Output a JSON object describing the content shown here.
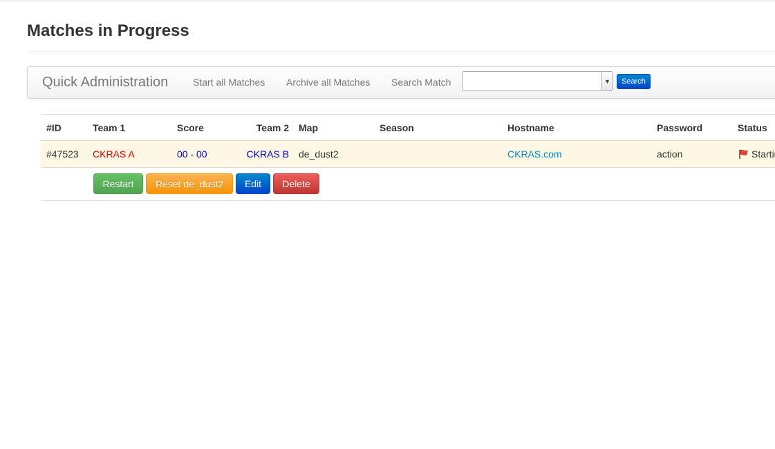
{
  "page": {
    "title": "Matches in Progress"
  },
  "navbar": {
    "brand": "Quick Administration",
    "links": {
      "start_all": "Start all Matches",
      "archive_all": "Archive all Matches"
    },
    "search_label": "Search Match",
    "search_select_value": "",
    "search_button": "Search"
  },
  "table": {
    "headers": {
      "id": "#ID",
      "team1": "Team 1",
      "score": "Score",
      "team2": "Team 2",
      "map": "Map",
      "season": "Season",
      "hostname": "Hostname",
      "password": "Password",
      "status": "Status"
    },
    "rows": [
      {
        "id": "#47523",
        "team1": "CKRAS A",
        "score": "00 - 00",
        "team2": "CKRAS B",
        "map": "de_dust2",
        "season": "",
        "hostname": "CKRAS.com",
        "password": "action",
        "status": "Starting"
      }
    ],
    "actions": {
      "restart": "Restart",
      "reset": "Reset de_dust2",
      "edit": "Edit",
      "delete": "Delete"
    }
  },
  "colors": {
    "team1": "#dd0000",
    "score": "#0000cc",
    "team2": "#0000cc",
    "link": "#0088cc",
    "row_highlight": "#fcf8e3",
    "btn_success": "#51a351",
    "btn_warning": "#f89406",
    "btn_primary": "#0044cc",
    "btn_danger": "#bd362f"
  },
  "icons": {
    "status": "flag-icon",
    "select": "chevron-down-icon"
  }
}
